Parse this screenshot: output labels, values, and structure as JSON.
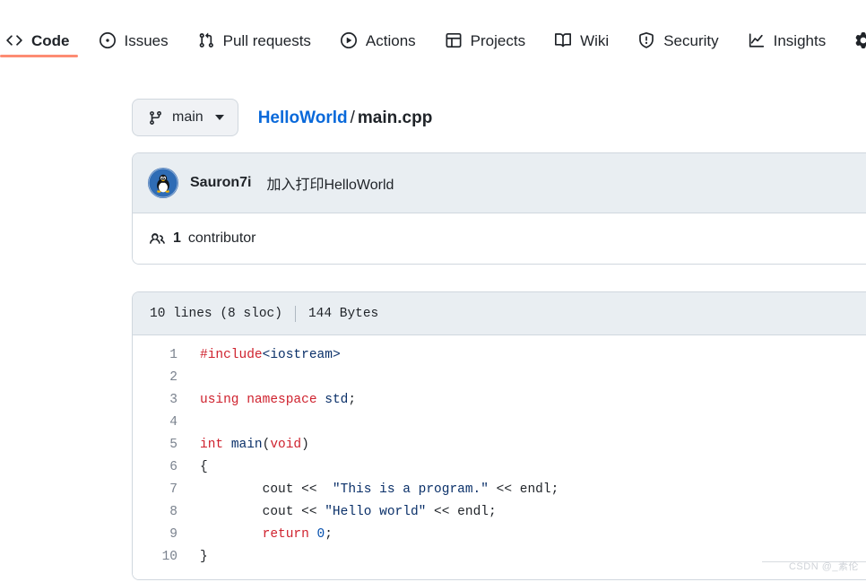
{
  "repo_nav": {
    "items": [
      {
        "label": "Code",
        "icon": "code-icon",
        "active": true
      },
      {
        "label": "Issues",
        "icon": "issue-opened-icon",
        "active": false
      },
      {
        "label": "Pull requests",
        "icon": "git-pull-request-icon",
        "active": false
      },
      {
        "label": "Actions",
        "icon": "play-icon",
        "active": false
      },
      {
        "label": "Projects",
        "icon": "table-icon",
        "active": false
      },
      {
        "label": "Wiki",
        "icon": "book-icon",
        "active": false
      },
      {
        "label": "Security",
        "icon": "shield-icon",
        "active": false
      },
      {
        "label": "Insights",
        "icon": "graph-icon",
        "active": false
      },
      {
        "label": "",
        "icon": "gear-icon",
        "active": false
      }
    ],
    "active_indicator_color": "#fd8c73"
  },
  "branch": {
    "name": "main",
    "icon": "git-branch-icon",
    "caret": "chevron-down-icon"
  },
  "breadcrumb": {
    "repo": "HelloWorld",
    "separator": "/",
    "file": "main.cpp"
  },
  "commit": {
    "avatar_icon": "tux-avatar",
    "author": "Sauron7i",
    "message": "加入打印HelloWorld"
  },
  "contributors": {
    "icon": "people-icon",
    "count": "1",
    "label": "contributor"
  },
  "file_meta": {
    "lines": "10 lines (8 sloc)",
    "size": "144 Bytes"
  },
  "code": {
    "language": "cpp",
    "lines": [
      {
        "n": "1",
        "tokens": [
          {
            "t": "#include",
            "c": "kw"
          },
          {
            "t": "<iostream>",
            "c": "id"
          }
        ]
      },
      {
        "n": "2",
        "tokens": []
      },
      {
        "n": "3",
        "tokens": [
          {
            "t": "using",
            "c": "kw"
          },
          {
            "t": " ",
            "c": "pn"
          },
          {
            "t": "namespace",
            "c": "kw"
          },
          {
            "t": " ",
            "c": "pn"
          },
          {
            "t": "std",
            "c": "id"
          },
          {
            "t": ";",
            "c": "pn"
          }
        ]
      },
      {
        "n": "4",
        "tokens": []
      },
      {
        "n": "5",
        "tokens": [
          {
            "t": "int",
            "c": "kw"
          },
          {
            "t": " ",
            "c": "pn"
          },
          {
            "t": "main",
            "c": "id"
          },
          {
            "t": "(",
            "c": "pn"
          },
          {
            "t": "void",
            "c": "kw"
          },
          {
            "t": ")",
            "c": "pn"
          }
        ]
      },
      {
        "n": "6",
        "tokens": [
          {
            "t": "{",
            "c": "pn"
          }
        ]
      },
      {
        "n": "7",
        "tokens": [
          {
            "t": "        cout << ",
            "c": "pn"
          },
          {
            "t": " \"This is a program.\"",
            "c": "str"
          },
          {
            "t": " << endl;",
            "c": "pn"
          }
        ]
      },
      {
        "n": "8",
        "tokens": [
          {
            "t": "        cout << ",
            "c": "pn"
          },
          {
            "t": "\"Hello world\"",
            "c": "str"
          },
          {
            "t": " << endl;",
            "c": "pn"
          }
        ]
      },
      {
        "n": "9",
        "tokens": [
          {
            "t": "        ",
            "c": "pn"
          },
          {
            "t": "return",
            "c": "kw"
          },
          {
            "t": " ",
            "c": "pn"
          },
          {
            "t": "0",
            "c": "num"
          },
          {
            "t": ";",
            "c": "pn"
          }
        ]
      },
      {
        "n": "10",
        "tokens": [
          {
            "t": "}",
            "c": "pn"
          }
        ]
      }
    ]
  },
  "watermark": {
    "text": "CSDN @_素伦"
  },
  "colors": {
    "link": "#0969da",
    "accent_underline": "#fd8c73",
    "panel_header": "#e9eef2",
    "border": "#d0d7de",
    "keyword": "#cf222e",
    "string": "#0a3069",
    "number": "#0550ae",
    "line_number": "#7a828e"
  }
}
